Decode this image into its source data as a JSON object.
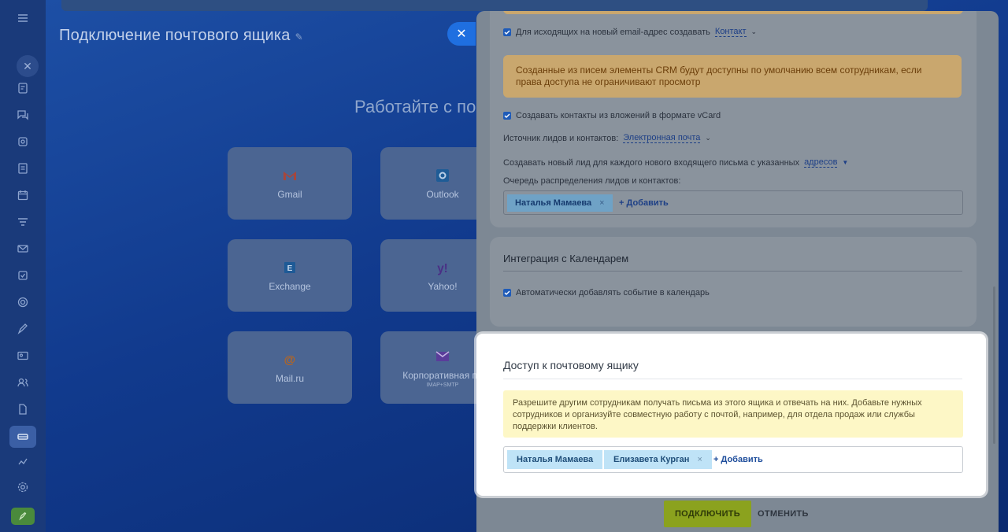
{
  "background_page": {
    "title": "Подключение почтового ящика",
    "heading": "Работайте с по",
    "services": [
      {
        "label": "Gmail",
        "sub": ""
      },
      {
        "label": "Outlook",
        "sub": ""
      },
      {
        "label": "Exchange",
        "sub": ""
      },
      {
        "label": "Yahoo!",
        "sub": ""
      },
      {
        "label": "Mail.ru",
        "sub": ""
      },
      {
        "label": "Корпоративная по",
        "sub": "IMAP+SMTP"
      }
    ]
  },
  "crm_settings": {
    "outgoing_label": "Для исходящих на новый email-адрес создавать",
    "outgoing_value": "Контакт",
    "warning": "Созданные из писем элементы CRM будут доступны по умолчанию всем сотрудникам, если права доступа не ограничивают просмотр",
    "vcard_label": "Создавать контакты из вложений в формате vCard",
    "source_label": "Источник лидов и контактов:",
    "source_value": "Электронная почта",
    "new_lead_label": "Создавать новый лид для каждого нового входящего письма с указанных",
    "new_lead_link": "адресов",
    "queue_label": "Очередь распределения лидов и контактов:",
    "queue_users": [
      "Наталья Мамаева"
    ],
    "add_label": "+ Добавить"
  },
  "calendar": {
    "title": "Интеграция с Календарем",
    "auto_add_label": "Автоматически добавлять событие в календарь"
  },
  "mailbox_access": {
    "title": "Доступ к почтовому ящику",
    "notice": "Разрешите другим сотрудникам получать письма из этого ящика и отвечать на них. Добавьте нужных сотрудников и организуйте совместную работу с почтой, например, для отдела продаж или службы поддержки клиентов.",
    "users": [
      "Наталья Мамаева",
      "Елизавета Курган"
    ],
    "add_label": "+ Добавить"
  },
  "footer": {
    "connect_label": "ПОДКЛЮЧИТЬ",
    "cancel_label": "ОТМЕНИТЬ"
  },
  "colors": {
    "connect_button": "#8ba21e",
    "notice_bg": "#fdf7c6",
    "tag_bg": "#bfe3f7"
  }
}
